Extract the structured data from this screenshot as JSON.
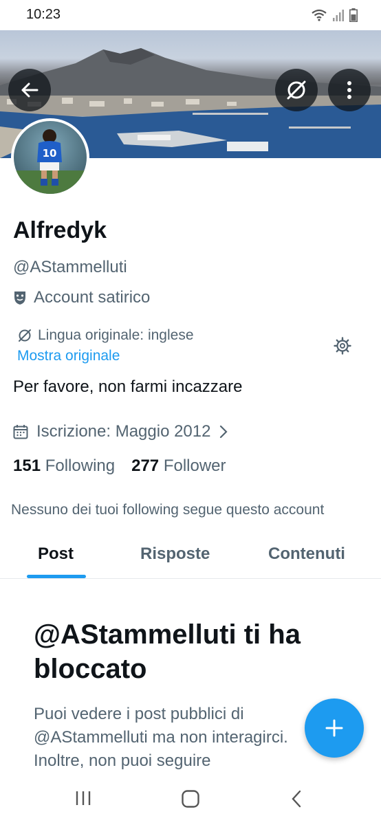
{
  "status_bar": {
    "time": "10:23",
    "icons": [
      "wifi-icon",
      "signal-icon",
      "battery-icon"
    ]
  },
  "header": {
    "back_icon": "arrow-left-icon",
    "translate_icon": "translate-icon",
    "more_icon": "more-vertical-icon",
    "banner": "Bay of Naples with Mount Vesuvius"
  },
  "profile": {
    "avatar": "player-number-10-avatar",
    "name": "Alfredyk",
    "handle": "@AStammelluti",
    "label_icon": "theater-mask-icon",
    "label": "Account satirico",
    "translation_note": "Lingua originale: inglese",
    "show_original": "Mostra originale",
    "bio": "Per favore, non farmi incazzare",
    "joined": "Iscrizione: Maggio 2012",
    "following_count": "151",
    "following_label": "Following",
    "followers_count": "277",
    "followers_label": "Follower",
    "mutual_note": "Nessuno dei tuoi following segue questo account"
  },
  "tabs": [
    {
      "label": "Post",
      "active": true
    },
    {
      "label": "Risposte",
      "active": false
    },
    {
      "label": "Contenuti",
      "active": false
    }
  ],
  "blocked": {
    "title": "@AStammelluti ti ha bloccato",
    "text": "Puoi vedere i post pubblici di\n@AStammelluti ma non interagirci.\nInoltre, non puoi seguire"
  },
  "fab": {
    "icon": "plus-icon"
  },
  "nav_bar": {
    "icons": [
      "recent-apps-icon",
      "home-icon",
      "back-icon"
    ]
  },
  "colors": {
    "accent": "#1d9bf0",
    "text": "#0f1419",
    "secondary": "#536471"
  }
}
